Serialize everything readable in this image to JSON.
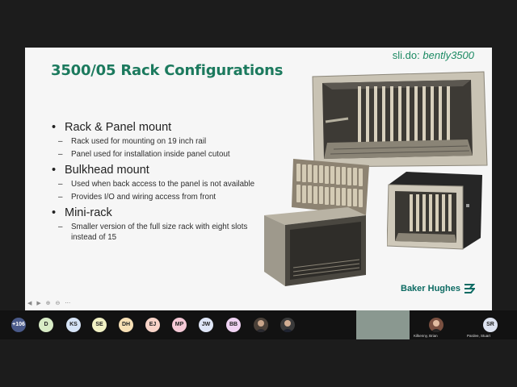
{
  "slide": {
    "title": "3500/05 Rack Configurations",
    "slido_prefix": "sli.do:",
    "slido_handle": "bently3500",
    "bullets": [
      {
        "text": "Rack & Panel mount",
        "subs": [
          "Rack used for mounting on 19 inch rail",
          "Panel used for installation inside panel cutout"
        ]
      },
      {
        "text": "Bulkhead mount",
        "subs": [
          "Used when back access to the panel is not available",
          "Provides I/O and wiring access from front"
        ]
      },
      {
        "text": "Mini-rack",
        "subs": [
          "Smaller version of the full size rack with eight slots instead of 15"
        ]
      }
    ],
    "logo": {
      "text": "Baker Hughes",
      "color": "#0d6b63"
    }
  },
  "participants": {
    "overflow_count": "+106",
    "avatars": [
      {
        "initials": "D",
        "color": "#d8ecc6"
      },
      {
        "initials": "KS",
        "color": "#d6e4f7"
      },
      {
        "initials": "SE",
        "color": "#f1f1c4"
      },
      {
        "initials": "DH",
        "color": "#f7e0b5"
      },
      {
        "initials": "EJ",
        "color": "#f9d4c8"
      },
      {
        "initials": "MP",
        "color": "#f5c9d6"
      },
      {
        "initials": "JW",
        "color": "#dfe6f7"
      },
      {
        "initials": "BB",
        "color": "#f0d3f3"
      }
    ],
    "video_tiles": [
      {
        "name": "Kilkenny, Brian"
      },
      {
        "initials": "SR",
        "name": "Pardee, Stuart"
      }
    ]
  },
  "colors": {
    "accent": "#1c7a5e",
    "slide_bg": "#f6f6f6",
    "bar_bg": "#121212"
  }
}
